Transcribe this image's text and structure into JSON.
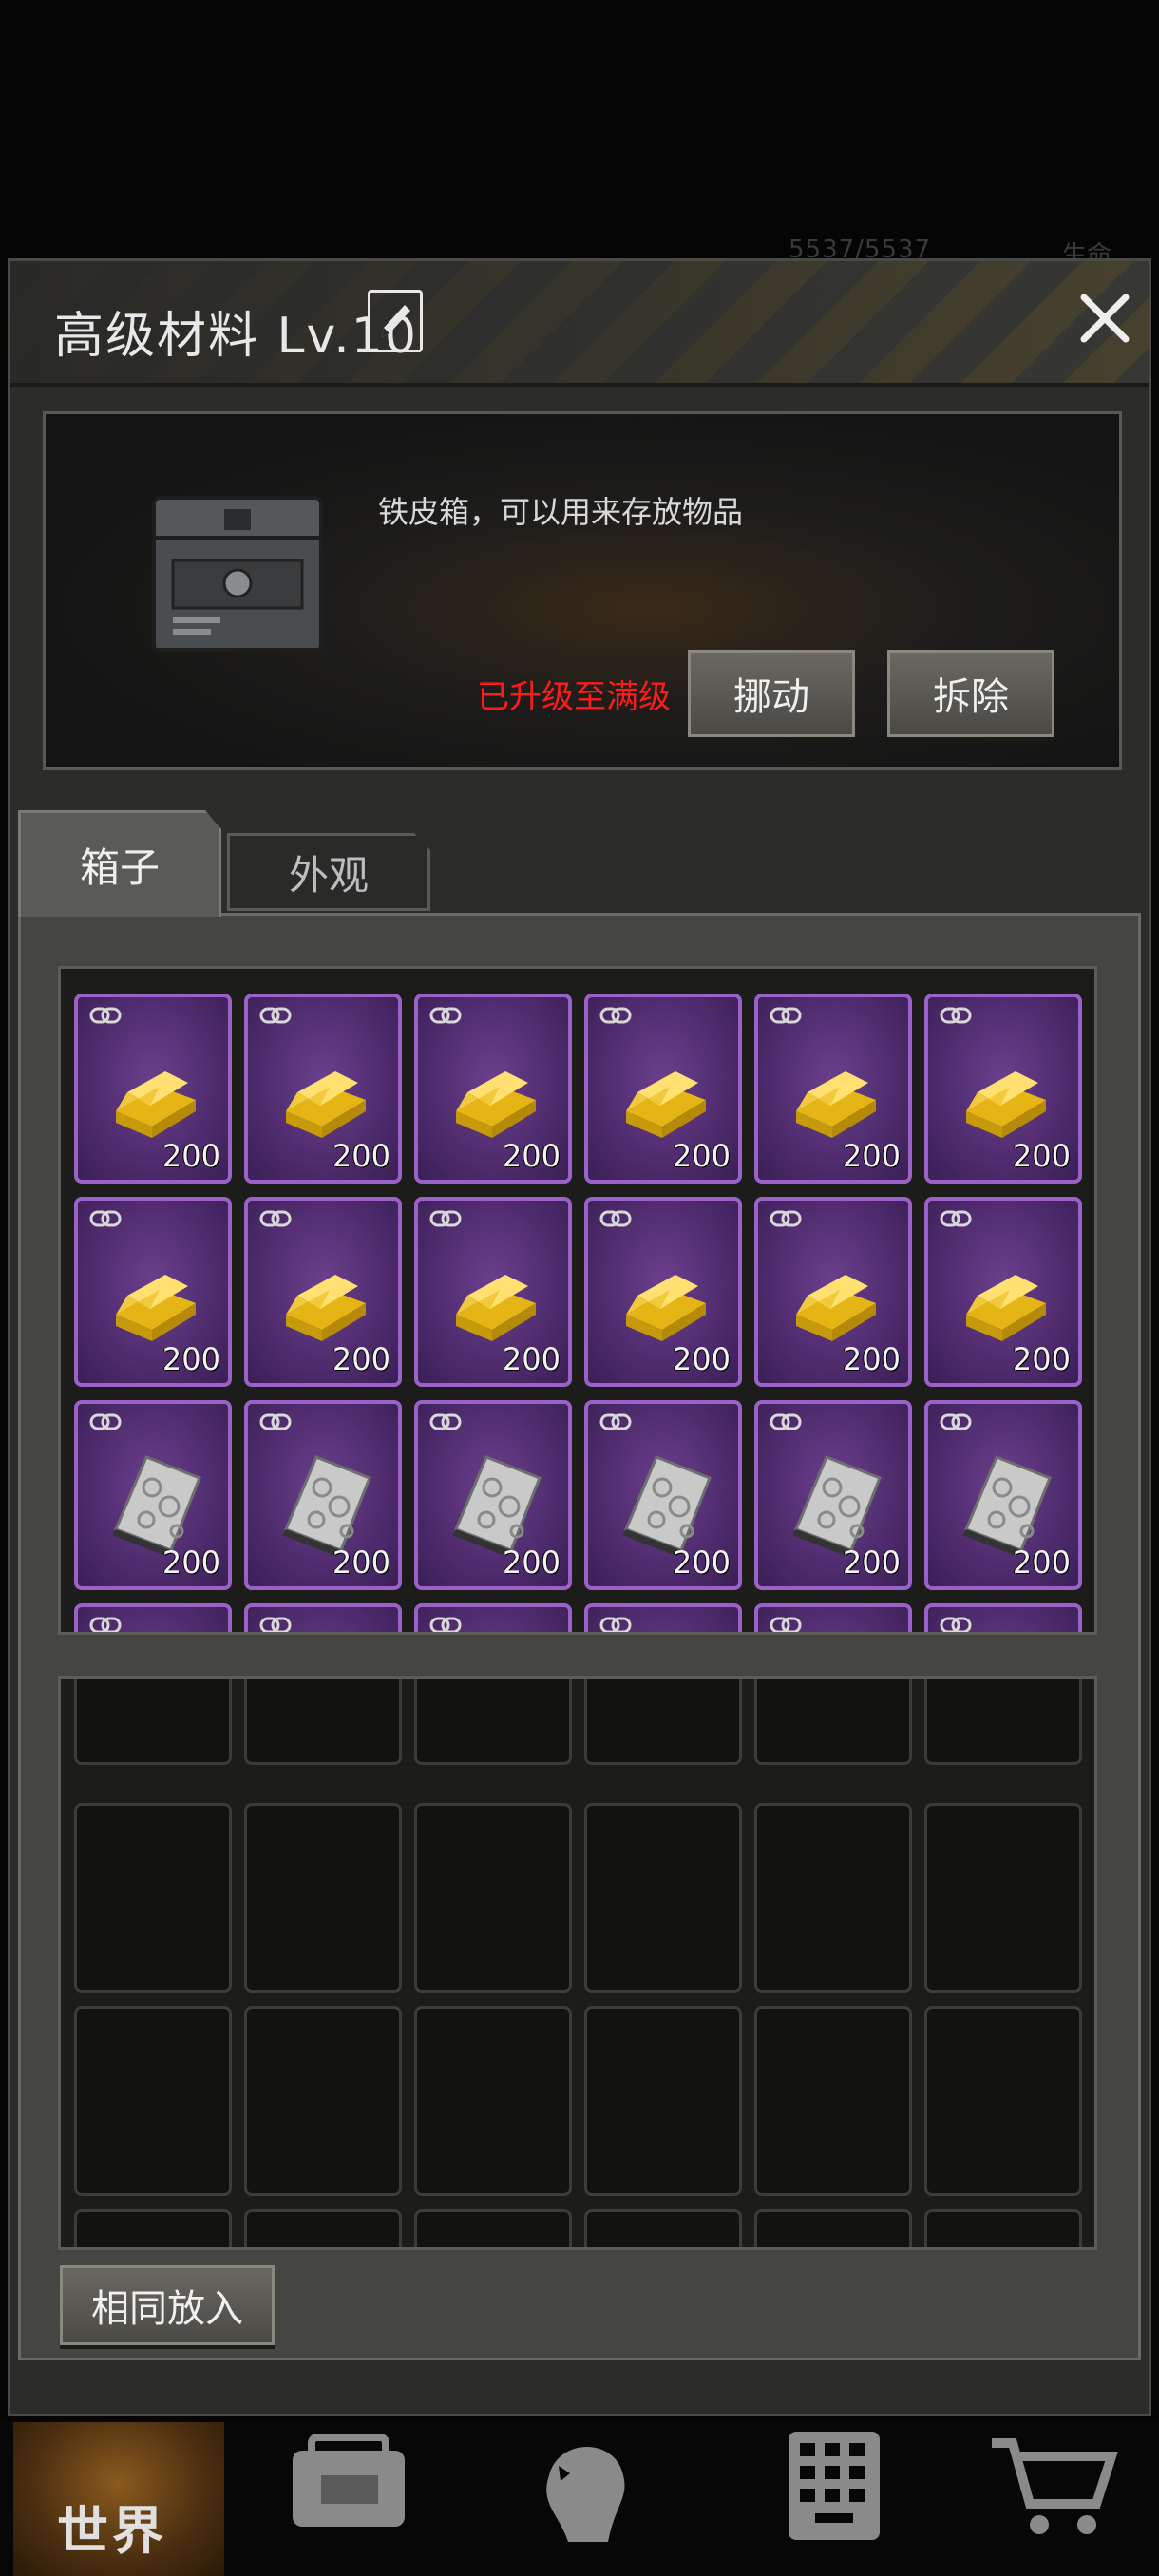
{
  "status_bar": {
    "hp": "5537/5537",
    "extra": "生命"
  },
  "header": {
    "title": "高级材料 Lv.10",
    "edit_icon": "pencil-icon",
    "close_icon": "close-icon"
  },
  "info": {
    "description": "铁皮箱，可以用来存放物品",
    "status": "已升级至满级",
    "move_label": "挪动",
    "remove_label": "拆除"
  },
  "tabs": [
    {
      "label": "箱子",
      "active": true
    },
    {
      "label": "外观",
      "active": false
    }
  ],
  "box_items": [
    {
      "type": "gold-bar",
      "qty": "200"
    },
    {
      "type": "gold-bar",
      "qty": "200"
    },
    {
      "type": "gold-bar",
      "qty": "200"
    },
    {
      "type": "gold-bar",
      "qty": "200"
    },
    {
      "type": "gold-bar",
      "qty": "200"
    },
    {
      "type": "gold-bar",
      "qty": "200"
    },
    {
      "type": "gold-bar",
      "qty": "200"
    },
    {
      "type": "gold-bar",
      "qty": "200"
    },
    {
      "type": "gold-bar",
      "qty": "200"
    },
    {
      "type": "gold-bar",
      "qty": "200"
    },
    {
      "type": "gold-bar",
      "qty": "200"
    },
    {
      "type": "gold-bar",
      "qty": "200"
    },
    {
      "type": "silver-plate",
      "qty": "200"
    },
    {
      "type": "silver-plate",
      "qty": "200"
    },
    {
      "type": "silver-plate",
      "qty": "200"
    },
    {
      "type": "silver-plate",
      "qty": "200"
    },
    {
      "type": "silver-plate",
      "qty": "200"
    },
    {
      "type": "silver-plate",
      "qty": "200"
    }
  ],
  "actions": {
    "same_put_label": "相同放入"
  },
  "nav": {
    "world_label": "世界",
    "icons": [
      "globe-icon",
      "backpack-icon",
      "character-icon",
      "phone-icon",
      "cart-icon"
    ]
  },
  "colors": {
    "item_bg": "#4a2868",
    "item_border": "#9a62c8",
    "maxed_text": "#ff1b1b"
  }
}
